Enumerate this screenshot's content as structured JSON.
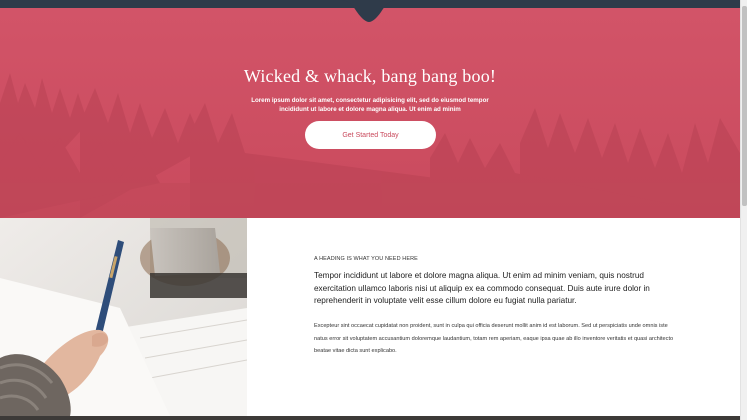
{
  "hero": {
    "title": "Wicked & whack, bang bang boo!",
    "subtitle": "Lorem ipsum dolor sit amet, consectetur adipisicing elit, sed do eiusmod tempor incididunt ut labore et dolore magna aliqua. Ut enim ad minim",
    "cta_label": "Get Started Today"
  },
  "content": {
    "heading": "A HEADING IS WHAT YOU NEED HERE",
    "lead": "Tempor incididunt ut labore et dolore magna aliqua. Ut enim ad minim veniam, quis nostrud exercitation ullamco laboris nisi ut aliquip ex ea commodo consequat. Duis aute irure dolor in reprehenderit in voluptate velit esse cillum dolore eu fugiat nulla pariatur.",
    "body": "Excepteur sint occaecat cupidatat non proident, sunt in culpa qui officia deserunt mollit anim id est laborum. Sed ut perspiciatis unde omnis iste natus error sit voluptatem accusantium doloremque laudantium, totam rem aperiam, eaque ipsa quae ab illo inventore veritatis et quasi architecto beatae vitae dicta sunt explicabo."
  },
  "colors": {
    "hero_bg": "#c94a5d",
    "topbar": "#2f3b4a",
    "cta_text": "#c94a5d"
  },
  "icons": {
    "photo": "hand-writing-with-pen-photo"
  }
}
